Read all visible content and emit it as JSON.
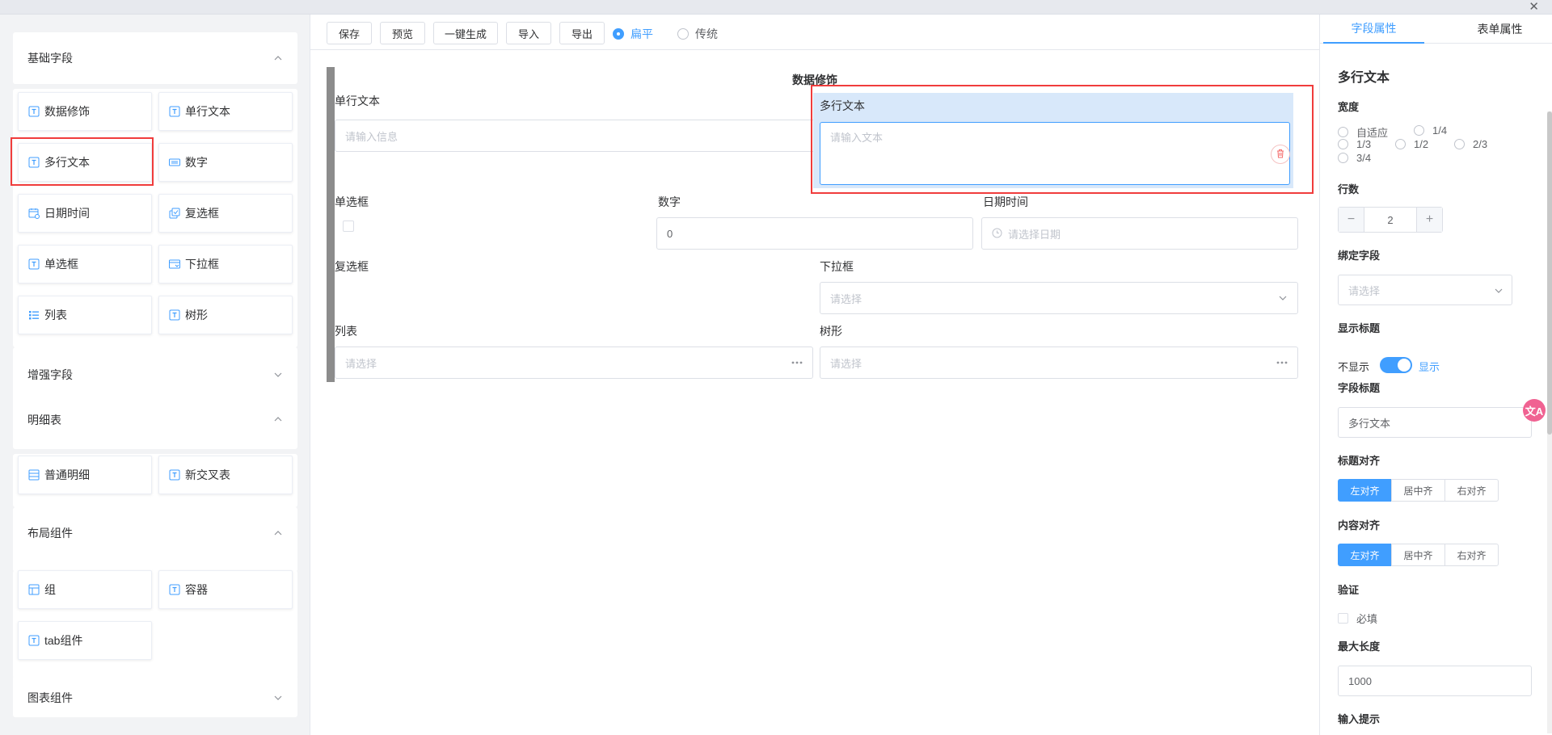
{
  "window": {
    "close_glyph": "✕"
  },
  "left": {
    "sections": [
      {
        "title": "基础字段",
        "expanded": true
      },
      {
        "title": "增强字段",
        "expanded": false
      },
      {
        "title": "明细表",
        "expanded": true
      },
      {
        "title": "布局组件",
        "expanded": true
      },
      {
        "title": "图表组件",
        "expanded": false
      }
    ],
    "basic_items": [
      {
        "label": "数据修饰",
        "icon": "text-field-icon"
      },
      {
        "label": "单行文本",
        "icon": "text-field-icon"
      },
      {
        "label": "多行文本",
        "icon": "text-field-icon",
        "selected": true
      },
      {
        "label": "数字",
        "icon": "number-icon"
      },
      {
        "label": "日期时间",
        "icon": "calendar-icon"
      },
      {
        "label": "复选框",
        "icon": "checkbox-icon"
      },
      {
        "label": "单选框",
        "icon": "text-field-icon"
      },
      {
        "label": "下拉框",
        "icon": "dropdown-icon"
      },
      {
        "label": "列表",
        "icon": "list-icon"
      },
      {
        "label": "树形",
        "icon": "text-field-icon"
      }
    ],
    "detail_items": [
      {
        "label": "普通明细",
        "icon": "table-icon"
      },
      {
        "label": "新交叉表",
        "icon": "text-field-icon"
      }
    ],
    "layout_items": [
      {
        "label": "组",
        "icon": "group-icon"
      },
      {
        "label": "容器",
        "icon": "text-field-icon"
      },
      {
        "label": "tab组件",
        "icon": "text-field-icon"
      }
    ]
  },
  "toolbar": {
    "save": "保存",
    "preview": "预览",
    "generate": "一键生成",
    "import": "导入",
    "export": "导出",
    "mode_flat": "扁平",
    "mode_traditional": "传统",
    "selected_mode": "扁平"
  },
  "canvas": {
    "section_title": "数据修饰",
    "single_text": {
      "label": "单行文本",
      "placeholder": "请输入信息"
    },
    "multi_text": {
      "label": "多行文本",
      "placeholder": "请输入文本"
    },
    "radio": {
      "label": "单选框"
    },
    "number": {
      "label": "数字",
      "value": "0"
    },
    "datetime": {
      "label": "日期时间",
      "placeholder": "请选择日期"
    },
    "checkbox": {
      "label": "复选框"
    },
    "dropdown": {
      "label": "下拉框",
      "placeholder": "请选择"
    },
    "list": {
      "label": "列表",
      "placeholder": "请选择"
    },
    "tree": {
      "label": "树形",
      "placeholder": "请选择"
    }
  },
  "right": {
    "tabs": [
      "字段属性",
      "表单属性"
    ],
    "active_tab": "字段属性",
    "field_title": "多行文本",
    "width_label": "宽度",
    "width_options": [
      "自适应",
      "1/4",
      "1/3",
      "1/2",
      "2/3",
      "3/4"
    ],
    "rows_label": "行数",
    "rows_value": "2",
    "bind_label": "绑定字段",
    "bind_placeholder": "请选择",
    "show_title_label": "显示标题",
    "switch_off": "不显示",
    "switch_on": "显示",
    "switch_state": true,
    "caption_label": "字段标题",
    "caption_value": "多行文本",
    "title_align_label": "标题对齐",
    "content_align_label": "内容对齐",
    "align_options": [
      "左对齐",
      "居中齐",
      "右对齐"
    ],
    "title_align_selected": "左对齐",
    "content_align_selected": "左对齐",
    "validate_label": "验证",
    "required_label": "必填",
    "maxlen_label": "最大长度",
    "maxlen_value": "1000",
    "hint_label": "输入提示"
  },
  "colors": {
    "accent": "#409eff",
    "highlight": "#f03c3c",
    "selected_bg": "#d8e8fa"
  },
  "translate_badge": "文A"
}
